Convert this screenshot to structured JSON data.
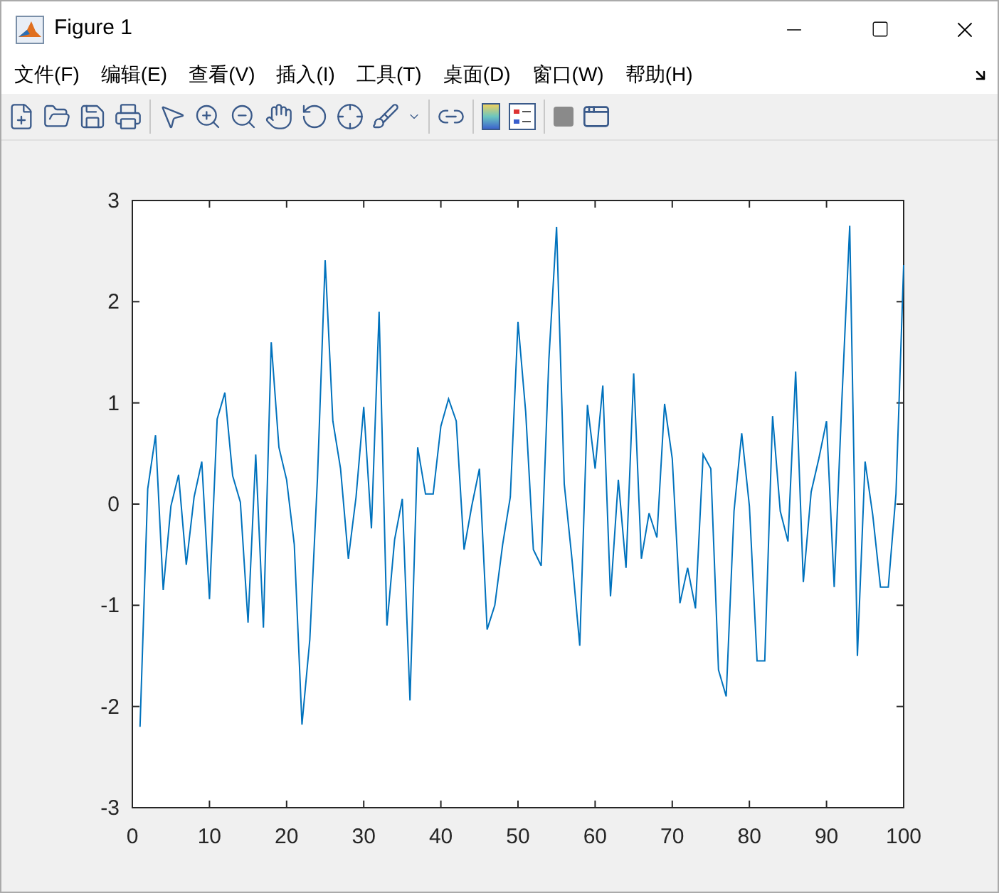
{
  "window": {
    "title": "Figure 1"
  },
  "menu": [
    {
      "label": "文件(F)"
    },
    {
      "label": "编辑(E)"
    },
    {
      "label": "查看(V)"
    },
    {
      "label": "插入(I)"
    },
    {
      "label": "工具(T)"
    },
    {
      "label": "桌面(D)"
    },
    {
      "label": "窗口(W)"
    },
    {
      "label": "帮助(H)"
    }
  ],
  "chart_data": {
    "type": "line",
    "x": [
      1,
      2,
      3,
      4,
      5,
      6,
      7,
      8,
      9,
      10,
      11,
      12,
      13,
      14,
      15,
      16,
      17,
      18,
      19,
      20,
      21,
      22,
      23,
      24,
      25,
      26,
      27,
      28,
      29,
      30,
      31,
      32,
      33,
      34,
      35,
      36,
      37,
      38,
      39,
      40,
      41,
      42,
      43,
      44,
      45,
      46,
      47,
      48,
      49,
      50,
      51,
      52,
      53,
      54,
      55,
      56,
      57,
      58,
      59,
      60,
      61,
      62,
      63,
      64,
      65,
      66,
      67,
      68,
      69,
      70,
      71,
      72,
      73,
      74,
      75,
      76,
      77,
      78,
      79,
      80,
      81,
      82,
      83,
      84,
      85,
      86,
      87,
      88,
      89,
      90,
      91,
      92,
      93,
      94,
      95,
      96,
      97,
      98,
      99,
      100
    ],
    "series": [
      {
        "color": "#0072bd",
        "values": [
          -2.2,
          0.15,
          0.68,
          -0.85,
          -0.02,
          0.29,
          -0.6,
          0.07,
          0.42,
          -0.94,
          0.84,
          1.1,
          0.28,
          0.02,
          -1.17,
          0.49,
          -1.22,
          1.6,
          0.56,
          0.24,
          -0.4,
          -2.18,
          -1.34,
          0.26,
          2.41,
          0.82,
          0.35,
          -0.54,
          0.07,
          0.96,
          -0.24,
          1.9,
          -1.2,
          -0.35,
          0.05,
          -1.94,
          0.56,
          0.1,
          0.1,
          0.77,
          1.04,
          0.82,
          -0.45,
          -0.02,
          0.35,
          -1.24,
          -1.0,
          -0.4,
          0.07,
          1.8,
          0.91,
          -0.45,
          -0.61,
          1.43,
          2.74,
          0.2,
          -0.54,
          -1.4,
          0.98,
          0.35,
          1.17,
          -0.91,
          0.24,
          -0.63,
          1.29,
          -0.54,
          -0.09,
          -0.33,
          0.99,
          0.45,
          -0.98,
          -0.63,
          -1.03,
          0.49,
          0.35,
          -1.64,
          -1.9,
          -0.07,
          0.7,
          -0.02,
          -1.55,
          -1.55,
          0.87,
          -0.07,
          -0.37,
          1.31,
          -0.77,
          0.12,
          0.45,
          0.82,
          -0.82,
          1.03,
          2.75,
          -1.5,
          0.42,
          -0.11,
          -0.82,
          -0.82,
          0.1,
          2.36
        ]
      }
    ],
    "xlim": [
      0,
      100
    ],
    "ylim": [
      -3,
      3
    ],
    "xticks": [
      0,
      10,
      20,
      30,
      40,
      50,
      60,
      70,
      80,
      90,
      100
    ],
    "yticks": [
      -3,
      -2,
      -1,
      0,
      1,
      2,
      3
    ]
  }
}
